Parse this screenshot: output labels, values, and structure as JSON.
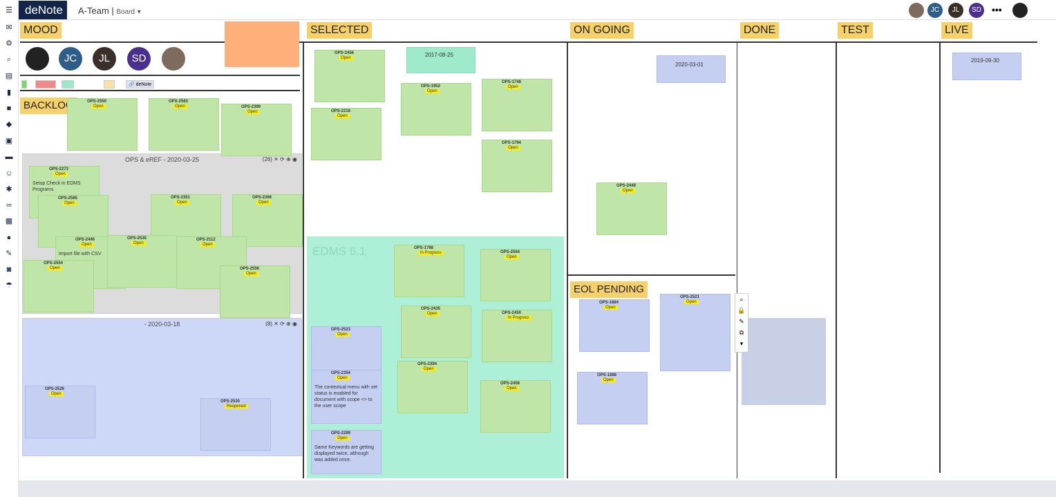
{
  "app": {
    "logo": "deNote",
    "team": "A-Team",
    "view": "Board"
  },
  "top_avatars": [
    {
      "initials": "",
      "color": "#7d6b5d"
    },
    {
      "initials": "JC",
      "color": "#2f5d8a"
    },
    {
      "initials": "JL",
      "color": "#3b2f2a"
    },
    {
      "initials": "SD",
      "color": "#4b2f8e"
    }
  ],
  "columns": [
    {
      "title": "MOOD"
    },
    {
      "title": "SELECTED"
    },
    {
      "title": "ON GOING"
    },
    {
      "title": "DONE"
    },
    {
      "title": "TEST"
    },
    {
      "title": "LIVE"
    }
  ],
  "backlog_title": "BACKLOG",
  "eol_title": "EOL PENDING",
  "mood_tags": [
    "",
    "",
    "",
    "",
    "deNote"
  ],
  "groups": [
    {
      "title": "OPS & eREF -  2020-03-25",
      "count": "(26)"
    },
    {
      "title": "  -  2020-03-18",
      "count": "(8)"
    }
  ],
  "epic_title": "EDMS 6.1",
  "cards": [
    {
      "id": "OPS-2550",
      "status": "Open",
      "text": ""
    },
    {
      "id": "OPS-2563",
      "status": "Open",
      "text": ""
    },
    {
      "id": "OPS-2399",
      "status": "Open",
      "text": ""
    },
    {
      "id": "OPS-2273",
      "status": "Open",
      "text": "Setup Check in EDMS Programs"
    },
    {
      "id": "OPS-2565",
      "status": "Open",
      "text": ""
    },
    {
      "id": "OPS-2301",
      "status": "Open",
      "text": ""
    },
    {
      "id": "OPS-2366",
      "status": "Open",
      "text": ""
    },
    {
      "id": "OPS-2446",
      "status": "Open",
      "text": "Import file with CSV"
    },
    {
      "id": "OPS-2535",
      "status": "Open",
      "text": ""
    },
    {
      "id": "OPS-2112",
      "status": "Open",
      "text": ""
    },
    {
      "id": "OPS-2554",
      "status": "Open",
      "text": ""
    },
    {
      "id": "OPS-2556",
      "status": "Open",
      "text": ""
    },
    {
      "id": "OPS-2526",
      "status": "Open",
      "text": ""
    },
    {
      "id": "OPS-2530",
      "status": "Reopened",
      "text": ""
    },
    {
      "id": "OPS-2456",
      "status": "Open",
      "text": ""
    },
    {
      "id": "OPS-2218",
      "status": "Open",
      "text": ""
    },
    {
      "id": "OPS-1952",
      "status": "Open",
      "text": ""
    },
    {
      "id": "OPS-1748",
      "status": "Open",
      "text": ""
    },
    {
      "id": "OPS-1794",
      "status": "Open",
      "text": ""
    },
    {
      "id": "OPS-1788",
      "status": "In Progress",
      "text": ""
    },
    {
      "id": "OPS-2564",
      "status": "Open",
      "text": ""
    },
    {
      "id": "OPS-2523",
      "status": "Open",
      "text": ""
    },
    {
      "id": "OPS-2435",
      "status": "Open",
      "text": ""
    },
    {
      "id": "OPS-2450",
      "status": "In Progress",
      "text": ""
    },
    {
      "id": "OPS-2354",
      "status": "Open",
      "text": "The contextual menu with set status is enabled for document with scope <> to the user scope"
    },
    {
      "id": "OPS-2394",
      "status": "Open",
      "text": ""
    },
    {
      "id": "OPS-2458",
      "status": "Open",
      "text": ""
    },
    {
      "id": "OPS-2299",
      "status": "Open",
      "text": "Same Keywords are getting displayed twice, although was added once."
    },
    {
      "id": "OPS-2449",
      "status": "Open",
      "text": ""
    },
    {
      "id": "OPS-1884",
      "status": "Open",
      "text": ""
    },
    {
      "id": "OPS-2521",
      "status": "Open",
      "text": ""
    },
    {
      "id": "OPS-1888",
      "status": "Open",
      "text": ""
    }
  ],
  "dated_items": [
    {
      "date": "2017-08-25"
    },
    {
      "date": "2020-03-01"
    },
    {
      "date": "2019-09-30"
    }
  ]
}
